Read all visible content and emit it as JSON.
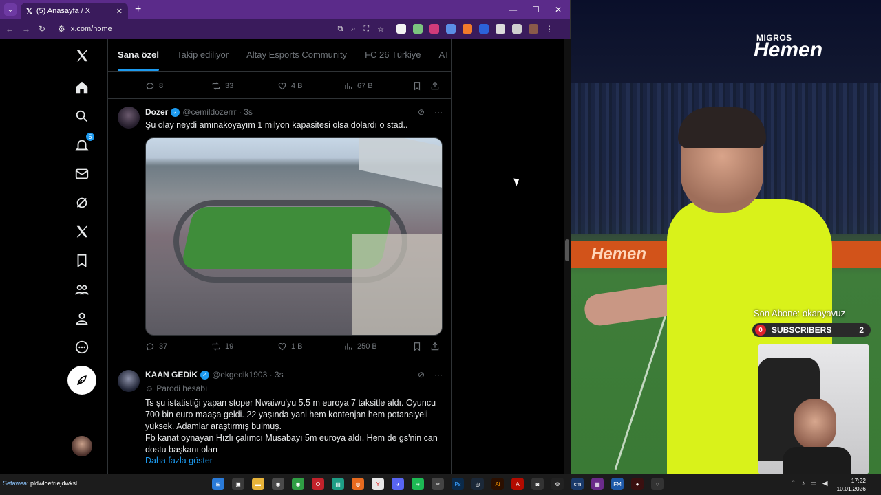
{
  "browser": {
    "tab_title": "(5) Anasayfa / X",
    "url": "x.com/home"
  },
  "nav": {
    "notifications_badge": "5"
  },
  "feed": {
    "tabs": [
      "Sana özel",
      "Takip ediliyor",
      "Altay Esports Community",
      "FC 26 Türkiye",
      "AT"
    ],
    "top_actions": {
      "replies": "8",
      "reposts": "33",
      "likes": "4 B",
      "views": "67 B"
    },
    "tweet1": {
      "name": "Dozer",
      "handle": "@cemildozerrr · 3s",
      "text": "Şu olay neydi amınakoyayım 1 milyon kapasitesi olsa dolardı o stad..",
      "replies": "37",
      "reposts": "19",
      "likes": "1 B",
      "views": "250 B"
    },
    "tweet2": {
      "name": "KAAN GEDİK",
      "handle": "@ekgedik1903 · 3s",
      "label": "Parodi hesabı",
      "text": "Ts şu istatistiği yapan  stoper Nwaiwu'yu 5.5 m euroya 7 taksitle aldı. Oyuncu 700 bin euro maaşa geldi. 22 yaşında yani hem kontenjan hem potansiyeli yüksek. Adamlar araştırmış bulmuş.\nFb kanat oynayan Hızlı çalımcı Musabayı 5m euroya aldı. Hem de gs'nin can dostu başkanı olan",
      "show_more": "Daha fazla göster"
    }
  },
  "stream": {
    "brand_small": "MIGROS",
    "brand_big": "Hemen",
    "adboard": "Hemen",
    "last_sub": "Son Abone: okanyavuz",
    "sub_left": "0",
    "sub_label": "SUBSCRIBERS",
    "sub_right": "2"
  },
  "taskbar": {
    "ticker_user": "Sefawea",
    "ticker_msg": ": pldwloefrıejdwksl",
    "time": "17:22",
    "date": "10.01.2026"
  }
}
